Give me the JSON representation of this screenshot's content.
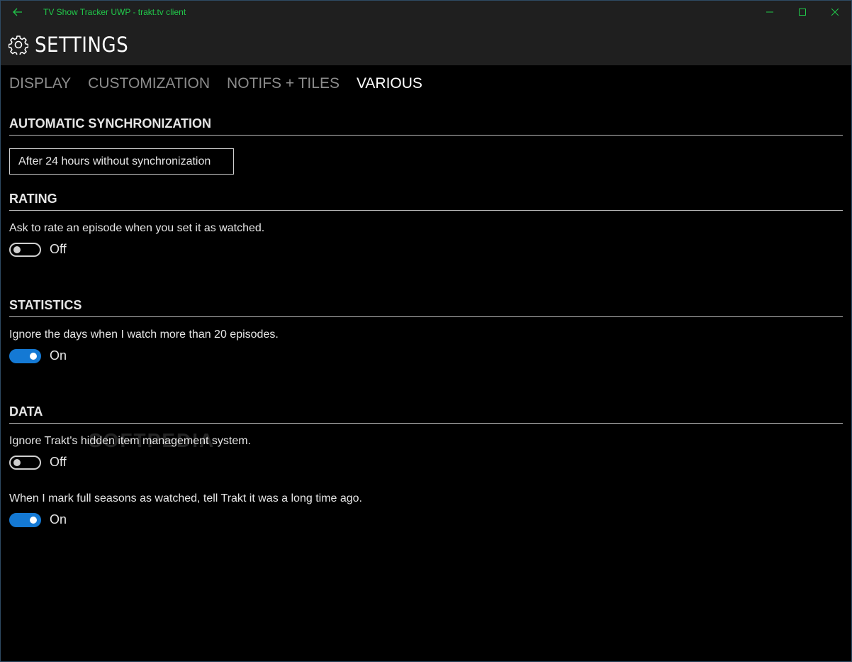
{
  "window": {
    "title": "TV Show Tracker UWP - trakt.tv client",
    "accent_color": "#21c84a"
  },
  "header": {
    "title": "SETTINGS",
    "icon": "gear-icon"
  },
  "tabs": [
    {
      "label": "DISPLAY",
      "active": false
    },
    {
      "label": "CUSTOMIZATION",
      "active": false
    },
    {
      "label": "NOTIFS + TILES",
      "active": false
    },
    {
      "label": "VARIOUS",
      "active": true
    }
  ],
  "sections": {
    "sync": {
      "title": "AUTOMATIC SYNCHRONIZATION",
      "dropdown_value": "After 24 hours without synchronization"
    },
    "rating": {
      "title": "RATING",
      "description": "Ask to rate an episode when you set it as watched.",
      "toggle_state": "Off"
    },
    "statistics": {
      "title": "STATISTICS",
      "description": "Ignore the days when I watch more than 20 episodes.",
      "toggle_state": "On"
    },
    "data": {
      "title": "DATA",
      "items": [
        {
          "description": "Ignore Trakt's hidden item management system.",
          "toggle_state": "Off"
        },
        {
          "description": "When I mark full seasons as watched, tell Trakt it was a long time ago.",
          "toggle_state": "On"
        }
      ]
    }
  },
  "watermark": "SOFTPEDIA",
  "colors": {
    "toggle_on": "#1479d4",
    "background": "#000000",
    "header_bg": "#1f1f1f"
  }
}
